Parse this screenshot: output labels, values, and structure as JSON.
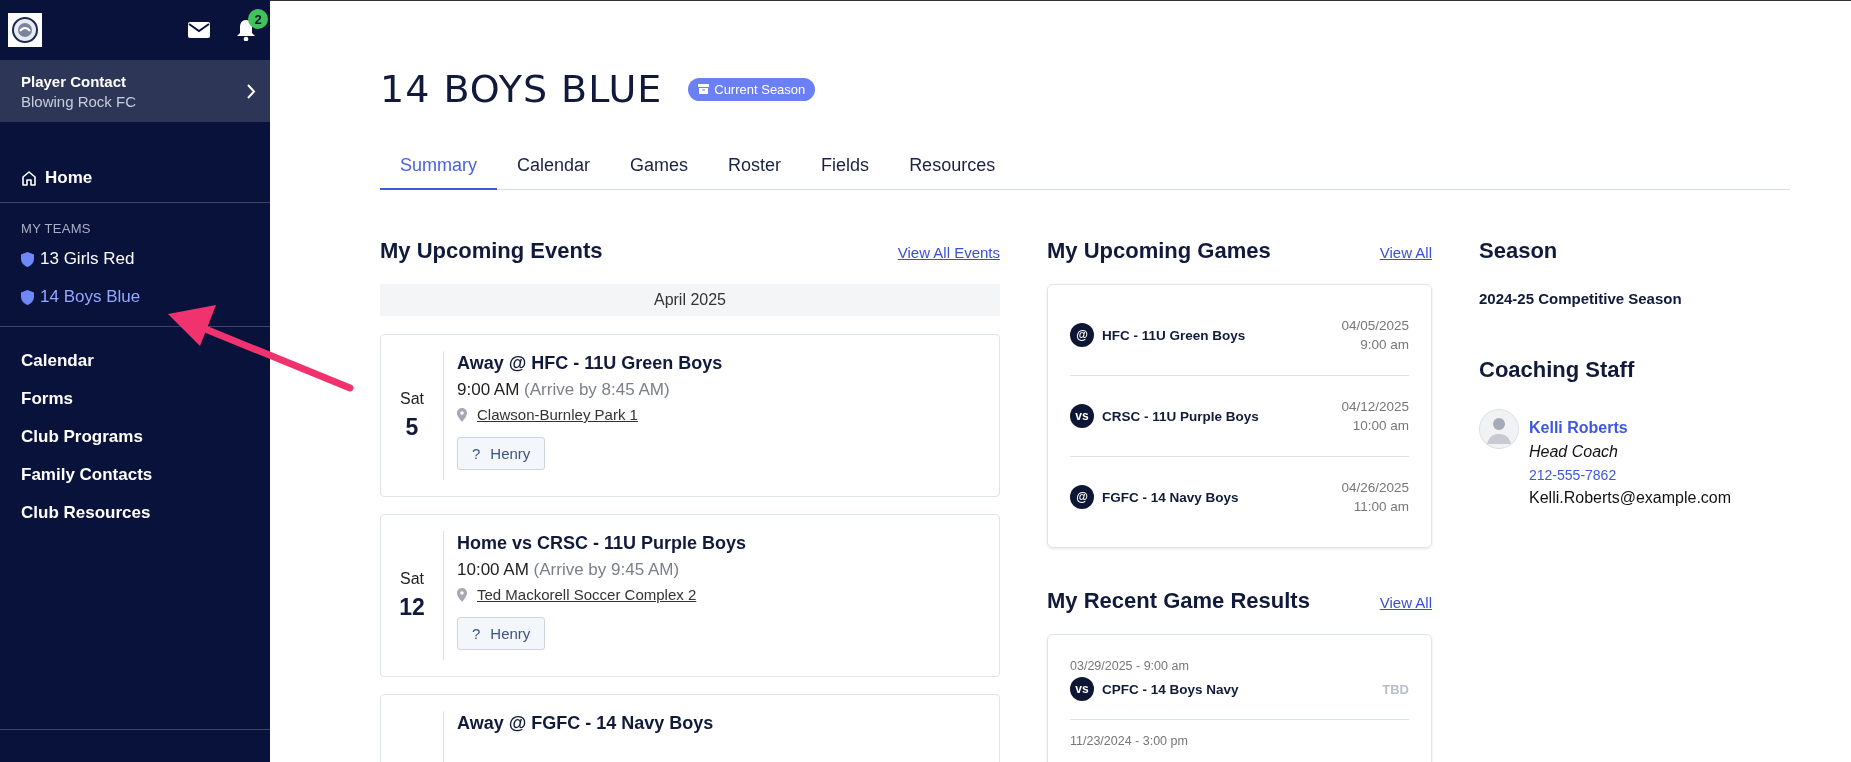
{
  "sidebar": {
    "notification_count": "2",
    "account": {
      "title": "Player Contact",
      "subtitle": "Blowing Rock FC"
    },
    "home": "Home",
    "teams_heading": "MY TEAMS",
    "teams": [
      {
        "label": "13 Girls Red",
        "selected": false
      },
      {
        "label": "14 Boys Blue",
        "selected": true
      }
    ],
    "links": [
      "Calendar",
      "Forms",
      "Club Programs",
      "Family Contacts",
      "Club Resources"
    ]
  },
  "header": {
    "title": "14 BOYS BLUE",
    "badge": "Current Season"
  },
  "tabs": [
    {
      "label": "Summary",
      "selected": true
    },
    {
      "label": "Calendar",
      "selected": false
    },
    {
      "label": "Games",
      "selected": false
    },
    {
      "label": "Roster",
      "selected": false
    },
    {
      "label": "Fields",
      "selected": false
    },
    {
      "label": "Resources",
      "selected": false
    }
  ],
  "events": {
    "title": "My Upcoming Events",
    "link": "View All Events",
    "month": "April 2025",
    "items": [
      {
        "weekday": "Sat",
        "day": "5",
        "title": "Away @ HFC - 11U Green Boys",
        "time": "9:00 AM",
        "arrive": "(Arrive by 8:45 AM)",
        "location": "Clawson-Burnley Park 1",
        "rsvp_mark": "?",
        "attendee": "Henry"
      },
      {
        "weekday": "Sat",
        "day": "12",
        "title": "Home vs CRSC - 11U Purple Boys",
        "time": "10:00 AM",
        "arrive": "(Arrive by 9:45 AM)",
        "location": "Ted Mackorell Soccer Complex 2",
        "rsvp_mark": "?",
        "attendee": "Henry"
      },
      {
        "title": "Away @ FGFC - 14 Navy Boys"
      }
    ]
  },
  "games": {
    "title": "My Upcoming Games",
    "link": "View All",
    "items": [
      {
        "marker": "@",
        "opponent": "HFC - 11U Green Boys",
        "date": "04/05/2025",
        "time": "9:00 am"
      },
      {
        "marker": "vs",
        "opponent": "CRSC - 11U Purple Boys",
        "date": "04/12/2025",
        "time": "10:00 am"
      },
      {
        "marker": "@",
        "opponent": "FGFC - 14 Navy Boys",
        "date": "04/26/2025",
        "time": "11:00 am"
      }
    ]
  },
  "results": {
    "title": "My Recent Game Results",
    "link": "View All",
    "items": [
      {
        "datetime": "03/29/2025 - 9:00 am",
        "marker": "vs",
        "opponent": "CPFC - 14 Boys Navy",
        "score": "TBD"
      },
      {
        "datetime": "11/23/2024 - 3:00 pm"
      }
    ]
  },
  "season": {
    "title": "Season",
    "value": "2024-25 Competitive Season"
  },
  "staff": {
    "title": "Coaching Staff",
    "members": [
      {
        "name": "Kelli Roberts",
        "role": "Head Coach",
        "phone": "212-555-7862",
        "email": "Kelli.Roberts@example.com"
      }
    ]
  }
}
